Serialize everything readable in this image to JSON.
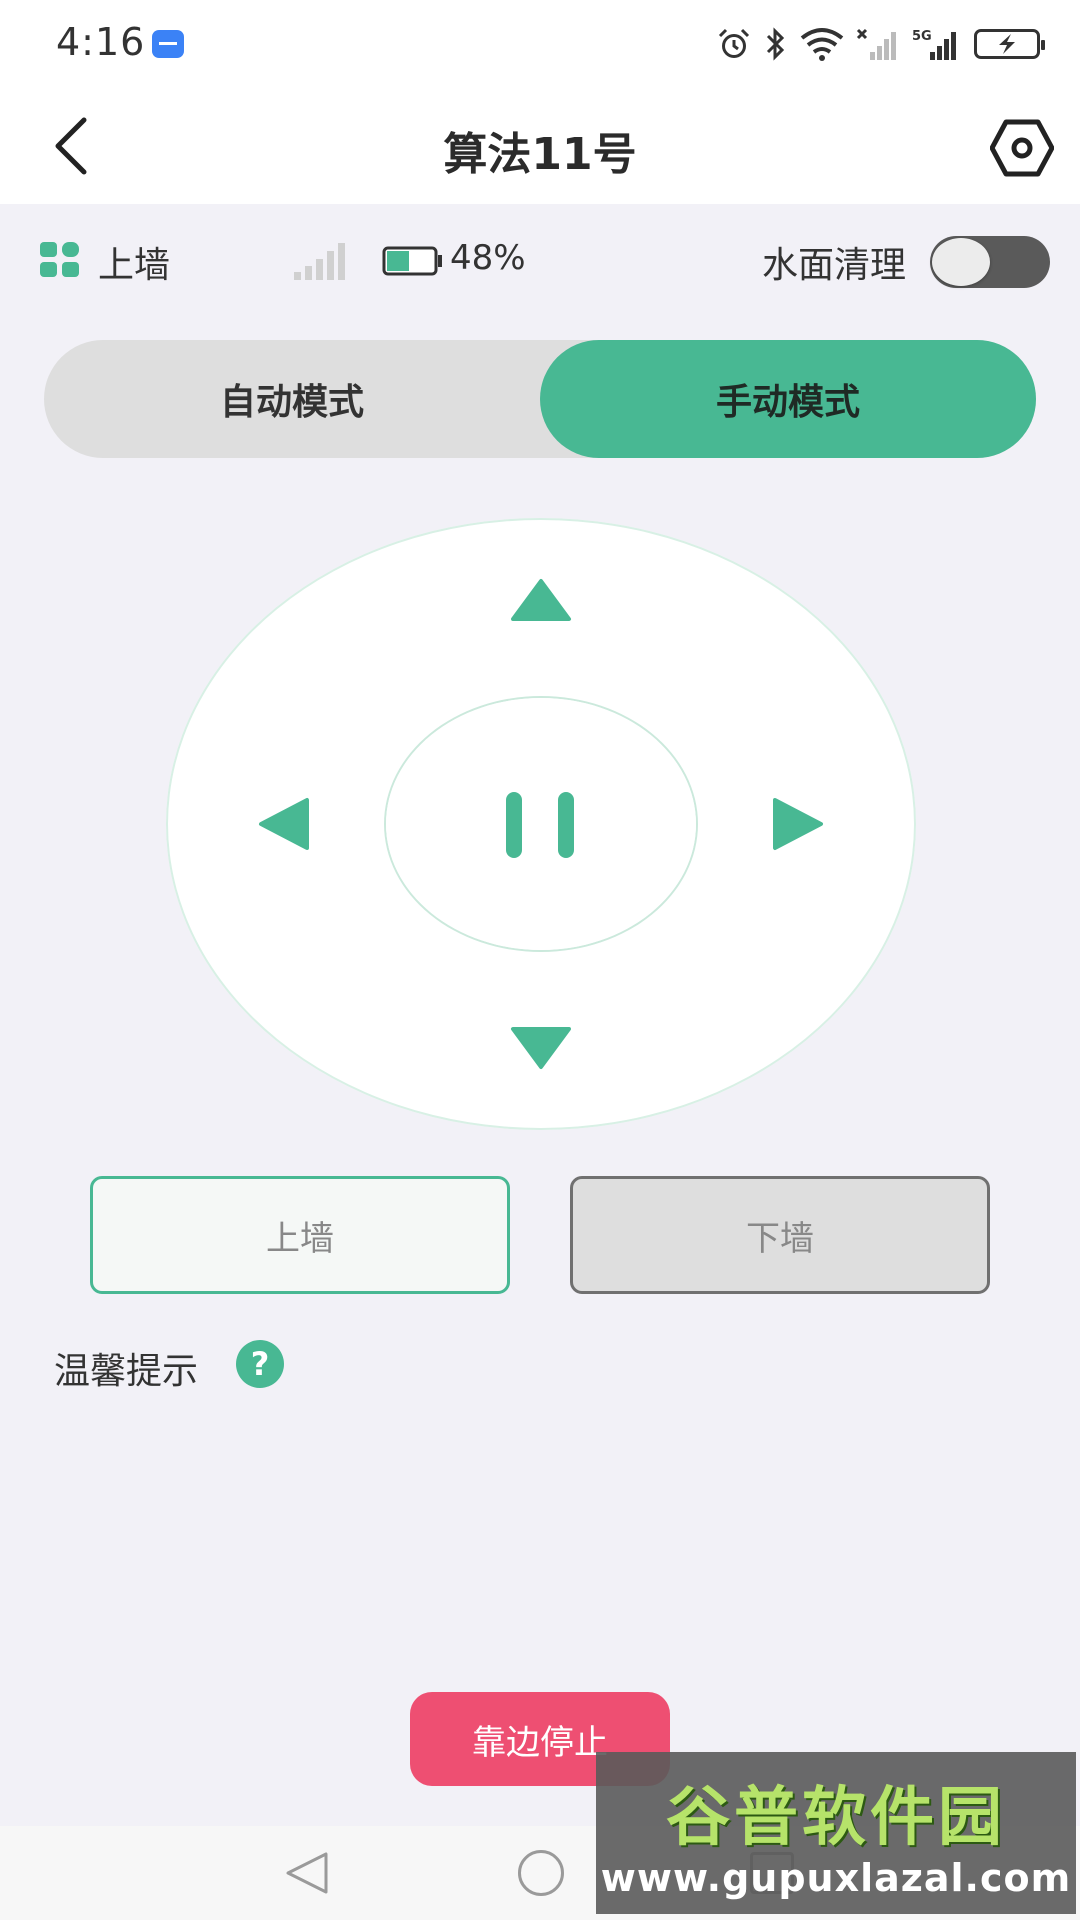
{
  "status_bar": {
    "time": "4:16"
  },
  "header": {
    "title": "算法11号",
    "back_icon": "chevron-left-icon",
    "settings_icon": "hexagon-settings-icon"
  },
  "info": {
    "wall_status": "上墙",
    "signal_level": 0,
    "battery_percent": 0.48,
    "battery_text": "48%",
    "water_clean_label": "水面清理",
    "water_clean_on": false
  },
  "mode": {
    "auto_label": "自动模式",
    "manual_label": "手动模式",
    "selected": "manual"
  },
  "walls": {
    "up_label": "上墙",
    "down_label": "下墙"
  },
  "tips": {
    "label": "温馨提示",
    "help_glyph": "?"
  },
  "stop_label": "靠边停止",
  "colors": {
    "accent": "#48b893",
    "stop": "#ee4f72",
    "background": "#f2f1f7"
  },
  "watermark": {
    "title": "谷普软件园",
    "url": "www.gupuxlazal.com"
  }
}
